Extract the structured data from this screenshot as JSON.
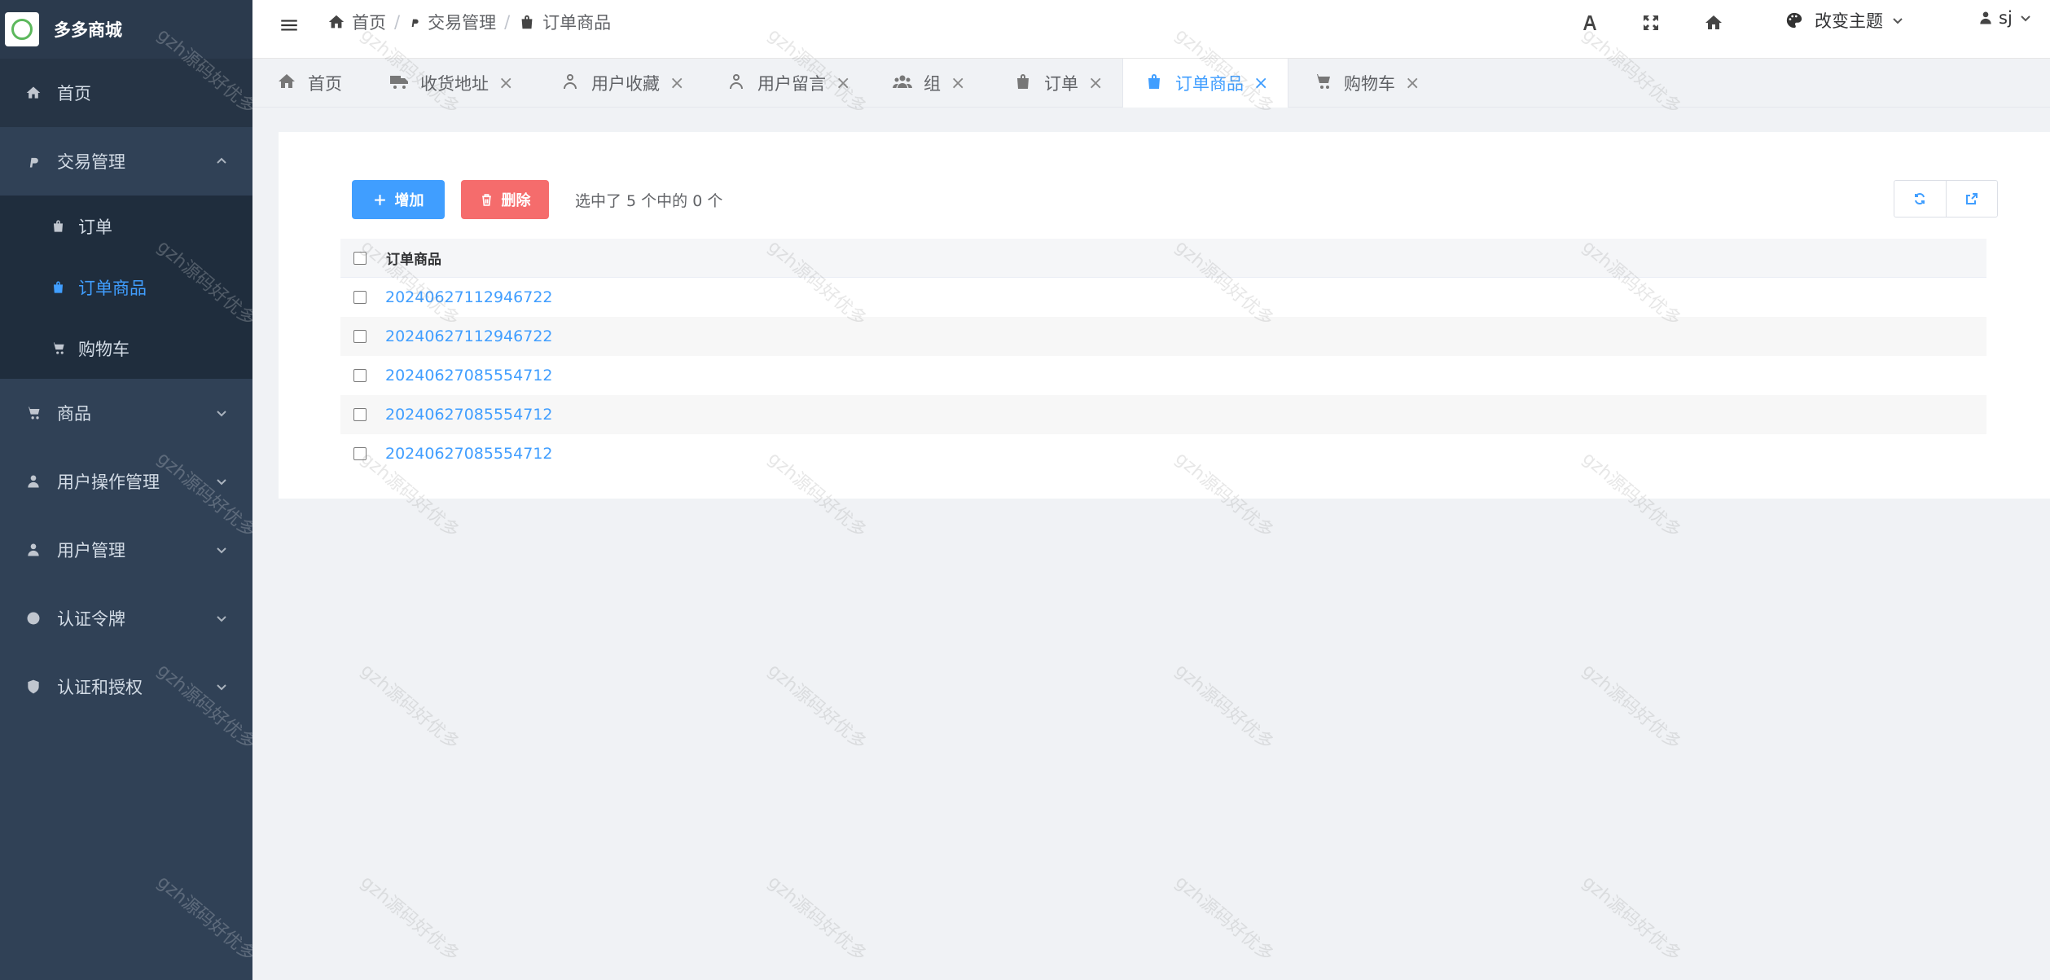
{
  "app": {
    "title": "多多商城"
  },
  "sidebar": {
    "home": "首页",
    "trade": {
      "label": "交易管理",
      "items": [
        "订单",
        "订单商品",
        "购物车"
      ],
      "active": 1
    },
    "sections": [
      "商品",
      "用户操作管理",
      "用户管理",
      "认证令牌",
      "认证和授权"
    ]
  },
  "header": {
    "breadcrumb": [
      "首页",
      "交易管理",
      "订单商品"
    ],
    "theme_label": "改变主题",
    "user": "sj"
  },
  "tabs": [
    "首页",
    "收货地址",
    "用户收藏",
    "用户留言",
    "组",
    "订单",
    "订单商品",
    "购物车"
  ],
  "toolbar": {
    "add": "增加",
    "delete": "删除",
    "selection": "选中了 5 个中的 0 个"
  },
  "table": {
    "header": "订单商品",
    "rows": [
      "20240627112946722",
      "20240627112946722",
      "20240627085554712",
      "20240627085554712",
      "20240627085554712"
    ]
  },
  "watermark": "gzh源码好优多",
  "colors": {
    "accent": "#409eff",
    "danger": "#f56c6c",
    "sidebar": "#304156"
  }
}
